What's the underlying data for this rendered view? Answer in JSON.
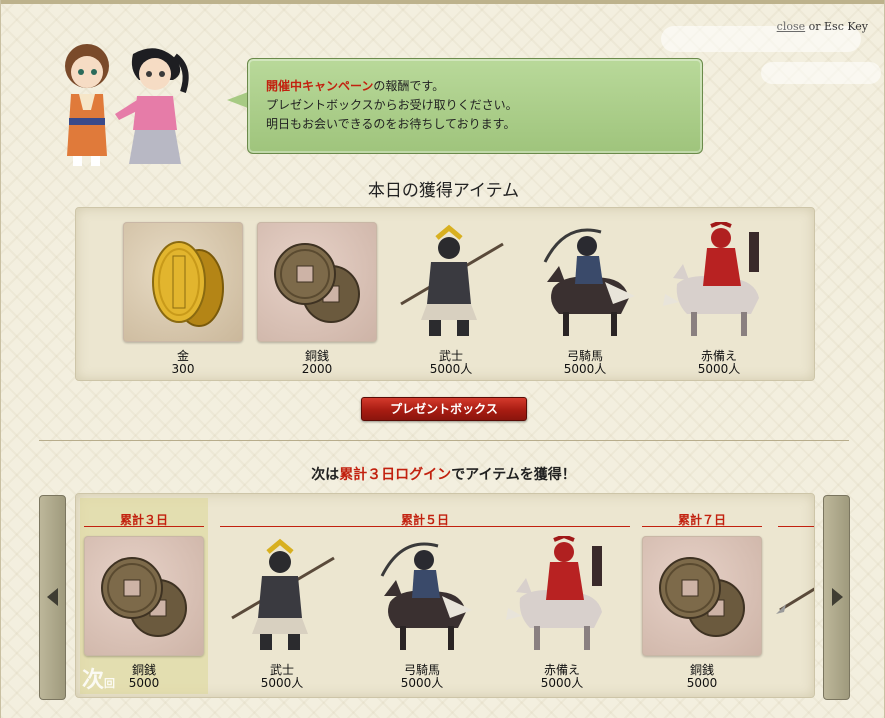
{
  "header": {
    "close_link": "close",
    "close_suffix": " or Esc Key"
  },
  "message": {
    "campaign": "開催中キャンペーン",
    "line1_rest": "の報酬です。",
    "line2": "プレゼントボックスからお受け取りください。",
    "line3": "明日もお会いできるのをお待ちしております。"
  },
  "today": {
    "title": "本日の獲得アイテム",
    "items": [
      {
        "name": "金",
        "qty": "300",
        "icon": "gold-koban-icon"
      },
      {
        "name": "銅銭",
        "qty": "2000",
        "icon": "copper-coin-icon"
      },
      {
        "name": "武士",
        "qty": "5000人",
        "icon": "samurai-unit-icon"
      },
      {
        "name": "弓騎馬",
        "qty": "5000人",
        "icon": "horse-archer-unit-icon"
      },
      {
        "name": "赤備え",
        "qty": "5000人",
        "icon": "red-armor-cavalry-icon"
      }
    ]
  },
  "present_button": "プレゼントボックス",
  "next": {
    "title_prefix": "次は",
    "title_highlight": "累計３日ログイン",
    "title_suffix": "でアイテムを獲得！",
    "next_mark": "次",
    "next_mark_small": "回",
    "day_labels": [
      "累計３日",
      "累計５日",
      "累計７日"
    ],
    "items": [
      {
        "name": "銅銭",
        "qty": "5000",
        "icon": "copper-coin-icon"
      },
      {
        "name": "武士",
        "qty": "5000人",
        "icon": "samurai-unit-icon"
      },
      {
        "name": "弓騎馬",
        "qty": "5000人",
        "icon": "horse-archer-unit-icon"
      },
      {
        "name": "赤備え",
        "qty": "5000人",
        "icon": "red-armor-cavalry-icon"
      },
      {
        "name": "銅銭",
        "qty": "5000",
        "icon": "copper-coin-icon"
      }
    ]
  },
  "colors": {
    "accent_red": "#c2210f",
    "bubble_green": "#a7ca83",
    "panel_bg": "#ece6d0"
  }
}
